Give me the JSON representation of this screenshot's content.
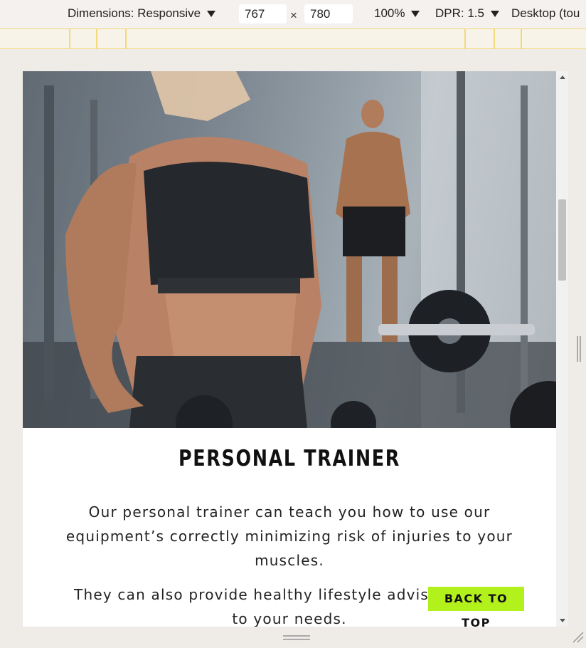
{
  "toolbar": {
    "dimensions_label": "Dimensions: Responsive",
    "width_value": "767",
    "times_symbol": "×",
    "height_value": "780",
    "zoom_label": "100%",
    "dpr_label": "DPR: 1.5",
    "device_mode_label": "Desktop (tou"
  },
  "page": {
    "heading": "PERSONAL TRAINER",
    "paragraph1": "Our personal trainer can teach you how to use our equipment’s correctly minimizing risk of injuries to your muscles.",
    "paragraph2": "They can also provide healthy lifestyle advise tailored to your needs.",
    "back_to_top": "BACK TO TOP",
    "accent_color": "#b3f11c"
  },
  "icons": {
    "dimensions_dropdown": "chevron-down-icon",
    "zoom_dropdown": "chevron-down-icon",
    "dpr_dropdown": "chevron-down-icon",
    "scroll_up": "arrow-up-icon",
    "scroll_down": "arrow-down-icon",
    "resize_handle": "resize-handle-icon"
  }
}
